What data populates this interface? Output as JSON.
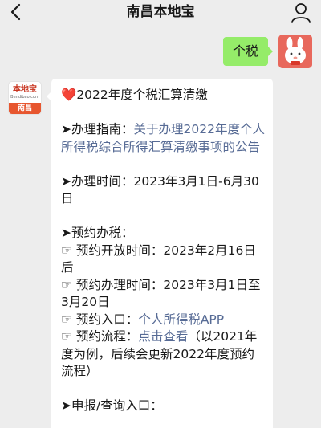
{
  "nav": {
    "title": "南昌本地宝",
    "back_icon": "chevron-left-icon",
    "profile_icon": "person-icon"
  },
  "outgoing": {
    "text": "个税"
  },
  "account": {
    "logo_text": "本地宝",
    "logo_sub": "Bendibao.com",
    "city": "南昌"
  },
  "message": {
    "title": "2022年度个税汇算清缴",
    "guide_label": "➤办理指南：",
    "guide_link": "关于办理2022年度个人所得税综合所得汇算清缴事项的公告",
    "time_label": "➤办理时间：",
    "time_value": "2023年3月1日-6月30日",
    "appt_label": "➤预约办税：",
    "open_label": "☞ 预约开放时间：",
    "open_value": "2023年2月16日后",
    "handle_label": "☞ 预约办理时间：",
    "handle_value": "2023年3月1日至3月20日",
    "entry_label": "☞ 预约入口：",
    "entry_link": "个人所得税APP",
    "flow_label": "☞ 预约流程：",
    "flow_link": "点击查看",
    "flow_note": "（以2021年度为例，后续会更新2022年度预约流程）",
    "report_label": "➤申报/查询入口："
  },
  "colors": {
    "bubble_out": "#95ec69",
    "link": "#576b95",
    "heart": "#e0262a",
    "background": "#ededed"
  }
}
